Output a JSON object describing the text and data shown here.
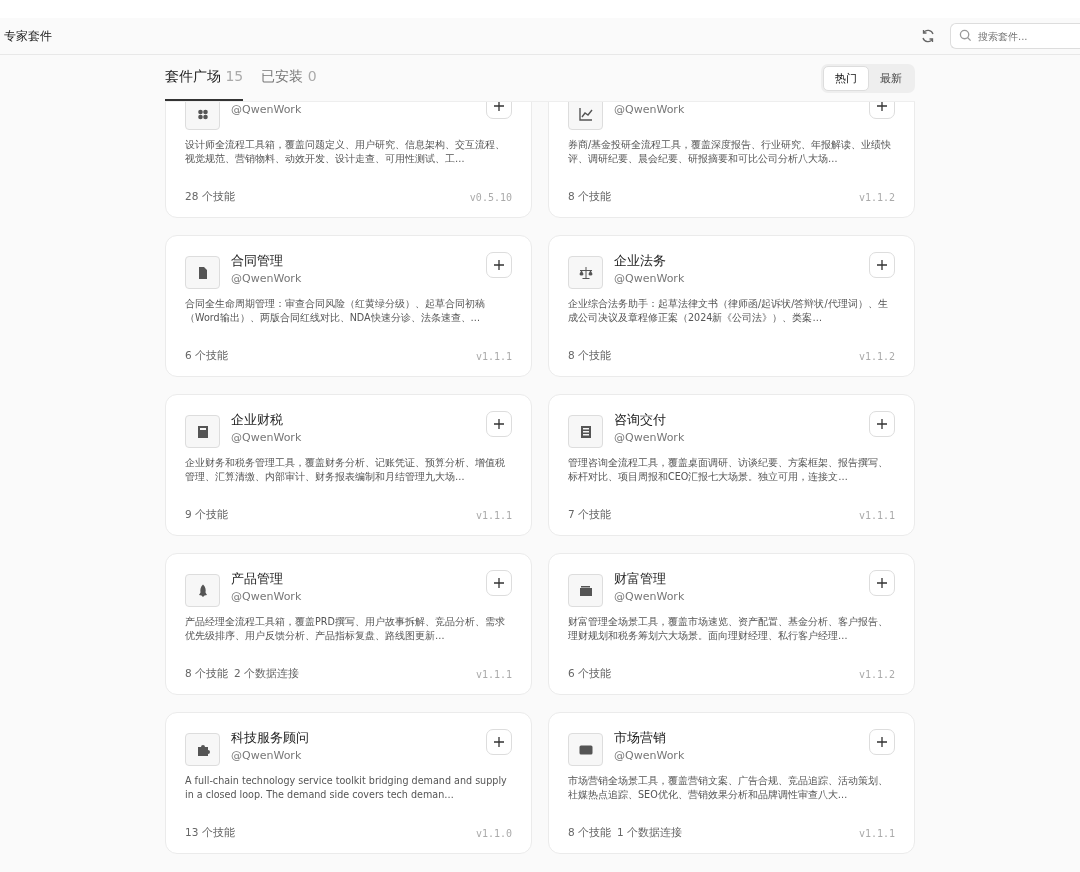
{
  "header": {
    "title": "专家套件",
    "search": {
      "placeholder": "搜索套件..."
    }
  },
  "tabs": [
    {
      "label": "套件广场",
      "count": "15",
      "selected": true
    },
    {
      "label": "已安装",
      "count": "0",
      "selected": false
    }
  ],
  "sort": [
    {
      "label": "热门",
      "selected": true
    },
    {
      "label": "最新",
      "selected": false
    }
  ],
  "cards": [
    {
      "author": "@QwenWork",
      "description": "设计师全流程工具箱，覆盖问题定义、用户研究、信息架构、交互流程、视觉规范、营销物料、动效开发、设计走查、可用性测试、工…",
      "stats": [
        "28 个技能"
      ],
      "version": "v0.5.10"
    },
    {
      "author": "@QwenWork",
      "description": "券商/基金投研全流程工具，覆盖深度报告、行业研究、年报解读、业绩快评、调研纪要、晨会纪要、研报摘要和可比公司分析八大场…",
      "stats": [
        "8 个技能"
      ],
      "version": "v1.1.2"
    },
    {
      "title": "合同管理",
      "author": "@QwenWork",
      "description": "合同全生命周期管理：审查合同风险（红黄绿分级）、起草合同初稿（Word输出）、两版合同红线对比、NDA快速分诊、法条速查、…",
      "stats": [
        "6 个技能"
      ],
      "version": "v1.1.1"
    },
    {
      "title": "企业法务",
      "author": "@QwenWork",
      "description": "企业综合法务助手：起草法律文书（律师函/起诉状/答辩状/代理词）、生成公司决议及章程修正案（2024新《公司法》）、类案…",
      "stats": [
        "8 个技能"
      ],
      "version": "v1.1.2"
    },
    {
      "title": "企业财税",
      "author": "@QwenWork",
      "description": "企业财务和税务管理工具，覆盖财务分析、记账凭证、预算分析、增值税管理、汇算清缴、内部审计、财务报表编制和月结管理九大场…",
      "stats": [
        "9 个技能"
      ],
      "version": "v1.1.1"
    },
    {
      "title": "咨询交付",
      "author": "@QwenWork",
      "description": "管理咨询全流程工具，覆盖桌面调研、访谈纪要、方案框架、报告撰写、标杆对比、项目周报和CEO汇报七大场景。独立可用，连接文…",
      "stats": [
        "7 个技能"
      ],
      "version": "v1.1.1"
    },
    {
      "title": "产品管理",
      "author": "@QwenWork",
      "description": "产品经理全流程工具箱，覆盖PRD撰写、用户故事拆解、竞品分析、需求优先级排序、用户反馈分析、产品指标复盘、路线图更新…",
      "stats": [
        "8 个技能",
        "2 个数据连接"
      ],
      "version": "v1.1.1"
    },
    {
      "title": "财富管理",
      "author": "@QwenWork",
      "description": "财富管理全场景工具，覆盖市场速览、资产配置、基金分析、客户报告、理财规划和税务筹划六大场景。面向理财经理、私行客户经理…",
      "stats": [
        "6 个技能"
      ],
      "version": "v1.1.2"
    },
    {
      "title": "科技服务顾问",
      "author": "@QwenWork",
      "description": "A full-chain technology service toolkit bridging demand and supply in a closed loop. The demand side covers tech deman…",
      "stats": [
        "13 个技能"
      ],
      "version": "v1.1.0"
    },
    {
      "title": "市场营销",
      "author": "@QwenWork",
      "description": "市场营销全场景工具，覆盖营销文案、广告合规、竞品追踪、活动策划、社媒热点追踪、SEO优化、营销效果分析和品牌调性审查八大…",
      "stats": [
        "8 个技能",
        "1 个数据连接"
      ],
      "version": "v1.1.1"
    }
  ]
}
